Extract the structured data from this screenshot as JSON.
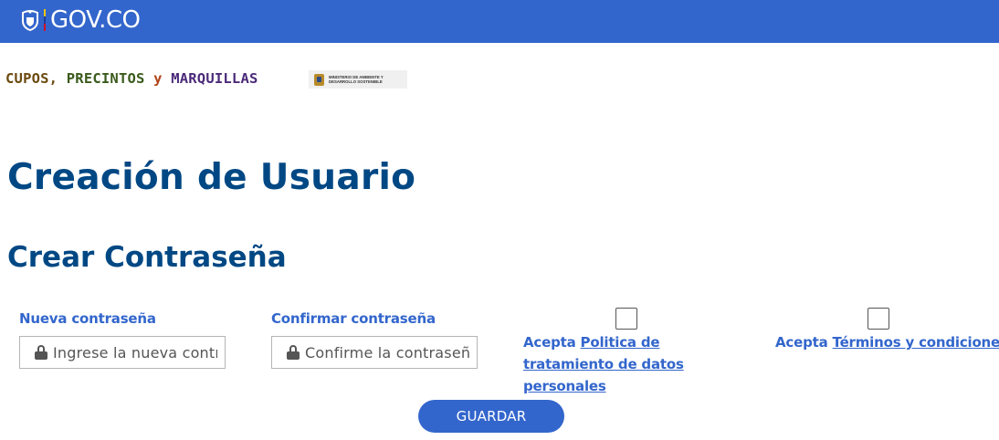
{
  "topbar": {
    "logo_text": "GOV.CO",
    "colors": {
      "background": "#3366cc"
    }
  },
  "brand": {
    "title_parts": [
      "CUPOS,",
      "PRECINTOS",
      "y",
      "MARQUILLAS"
    ],
    "ministry_line1": "MINISTERIO DE AMBIENTE Y",
    "ministry_line2": "DESARROLLO SOSTENIBLE"
  },
  "page": {
    "title": "Creación de Usuario",
    "subtitle": "Crear Contraseña"
  },
  "form": {
    "new_password": {
      "label": "Nueva contraseña",
      "placeholder": "Ingrese la nueva contraseña",
      "icon": "lock-icon"
    },
    "confirm_password": {
      "label": "Confirmar contraseña",
      "placeholder": "Confirme la contraseña",
      "icon": "lock-icon"
    },
    "privacy": {
      "prefix": "Acepta",
      "link": "Politica de tratamiento de datos personales",
      "checked": false
    },
    "terms": {
      "prefix": "Acepta",
      "link": "Términos y condiciones",
      "checked": false
    },
    "save_label": "GUARDAR"
  },
  "colors": {
    "primary": "#3366cc",
    "heading": "#004884"
  }
}
